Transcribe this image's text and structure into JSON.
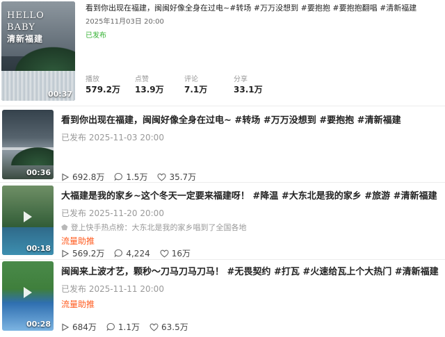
{
  "top": {
    "thumb_text_line1": "HELLO BABY",
    "thumb_text_line2": "清新福建",
    "duration": "00:37",
    "title": "看到你出现在福建，闽闽好像全身在过电~#转场 #万万没想到 #要抱抱 #要抱抱翻唱 #清新福建",
    "time": "2025年11月03日 20:00",
    "status": "已发布",
    "stats": [
      {
        "label": "播放",
        "value": "579.2万"
      },
      {
        "label": "点赞",
        "value": "13.9万"
      },
      {
        "label": "评论",
        "value": "7.1万"
      },
      {
        "label": "分享",
        "value": "33.1万"
      }
    ]
  },
  "rows": [
    {
      "duration": "00:36",
      "title": "看到你出现在福建，闽闽好像全身在过电~ #转场 #万万没想到 #要抱抱 #清新福建",
      "time": "已发布  2025-11-03 20:00",
      "views": "692.8万",
      "comments": "1.5万",
      "likes": "35.7万"
    },
    {
      "duration": "00:18",
      "title": "大福建是我的家乡~这个冬天一定要来福建呀！ #降温 #大东北是我的家乡 #旅游 #清新福建",
      "time": "已发布  2025-11-20 20:00",
      "trend": "登上快手热点榜：大东北是我的家乡唱到了全国各地",
      "promo": "流量助推",
      "views": "569.2万",
      "comments": "4,224",
      "likes": "16万"
    },
    {
      "duration": "00:28",
      "title": "闽闽来上波才艺，颗秒～刀马刀马刀马！ #无畏契约 #打瓦 #火速给瓦上个大热门 #清新福建",
      "time": "已发布  2025-11-11 20:00",
      "promo": "流量助推",
      "views": "684万",
      "comments": "1.1万",
      "likes": "63.5万"
    }
  ]
}
